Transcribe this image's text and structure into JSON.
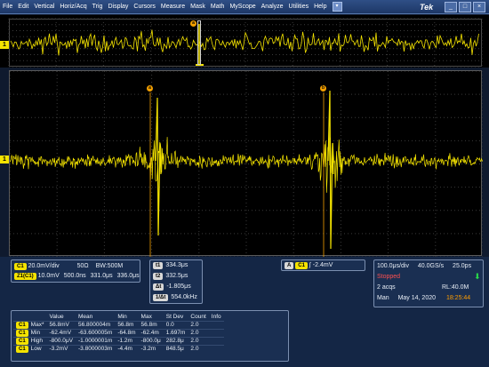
{
  "menu": [
    "File",
    "Edit",
    "Vertical",
    "Horiz/Acq",
    "Trig",
    "Display",
    "Cursors",
    "Measure",
    "Mask",
    "Math",
    "MyScope",
    "Analyze",
    "Utilities",
    "Help"
  ],
  "menu_dropdown_icon": "triangle-down",
  "brand": "Tek",
  "window_buttons": [
    "_",
    "□",
    "×"
  ],
  "colors": {
    "trace": "#f4e300",
    "background": "#000000",
    "panel": "#1a2f52",
    "stopped": "#ff5050",
    "time": "#ff9d00"
  },
  "overview": {
    "cursor_a": "a",
    "trigger_marker": "T"
  },
  "channel_marker": "1",
  "cursors": {
    "a_label": "a",
    "b_label": "b"
  },
  "channel_settings": {
    "c1": {
      "badge": "C1",
      "scale": "20.0mV/div",
      "impedance": "50Ω",
      "bandwidth": "BW:500M"
    },
    "z1": {
      "badge": "Z1(C1)",
      "scale": "10.0mV",
      "position": "500.0ns",
      "t1": "331.0μs",
      "t2": "336.0μs"
    }
  },
  "cursor_readout": [
    {
      "badge": "t1",
      "value": "334.3μs"
    },
    {
      "badge": "t2",
      "value": "332.5μs"
    },
    {
      "badge": "Δt",
      "value": "-1.805μs"
    },
    {
      "badge": "1/Δt",
      "value": "554.0kHz"
    }
  ],
  "trigger": {
    "mode": "A",
    "source": "C1",
    "slope": "∫",
    "level": "-2.4mV"
  },
  "acquisition": {
    "timebase": "100.0μs/div",
    "sample_rate": "40.0GS/s",
    "resolution": "25.0ps",
    "state": "Stopped",
    "acqs": "2 acqs",
    "record_length": "RL:40.0M",
    "mode": "Man",
    "date": "May 14, 2020",
    "time": "18:25:44"
  },
  "measurements": {
    "headers": [
      "",
      "Value",
      "Mean",
      "Min",
      "Max",
      "St Dev",
      "Count",
      "Info"
    ],
    "rows": [
      {
        "badge": "C1",
        "name": "Max*",
        "value": "56.8mV",
        "mean": "56.800004m",
        "min": "56.8m",
        "max": "56.8m",
        "stdev": "0.0",
        "count": "2.0",
        "info": ""
      },
      {
        "badge": "C1",
        "name": "Min",
        "value": "-62.4mV",
        "mean": "-63.600005m",
        "min": "-64.8m",
        "max": "-62.4m",
        "stdev": "1.697m",
        "count": "2.0",
        "info": ""
      },
      {
        "badge": "C1",
        "name": "High",
        "value": "-800.0μV",
        "mean": "-1.0000001m",
        "min": "-1.2m",
        "max": "-800.0μ",
        "stdev": "282.8μ",
        "count": "2.0",
        "info": ""
      },
      {
        "badge": "C1",
        "name": "Low",
        "value": "-3.2mV",
        "mean": "-3.8000003m",
        "min": "-4.4m",
        "max": "-3.2m",
        "stdev": "848.5μ",
        "count": "2.0",
        "info": ""
      }
    ]
  }
}
